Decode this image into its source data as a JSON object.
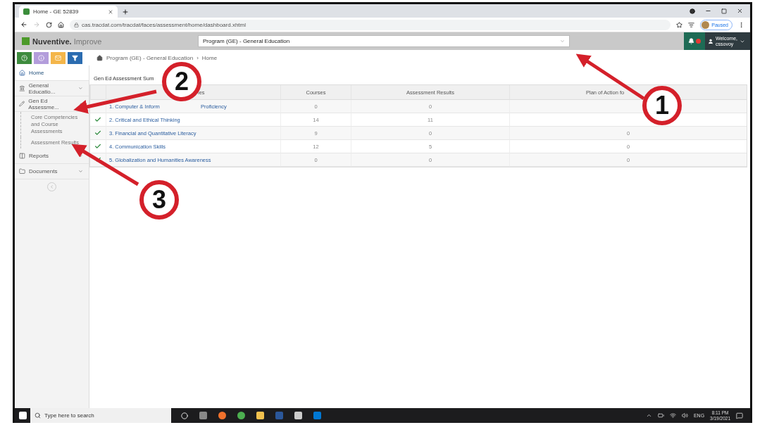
{
  "browser": {
    "tab": {
      "title": "Home - GE 52839"
    },
    "address": "cas.tracdat.com/tracdat/faces/assessment/home/dashboard.xhtml",
    "profile": "Paused"
  },
  "header": {
    "logo": {
      "brand": "Nuventive.",
      "product": "Improve"
    },
    "unit_select": {
      "value": "Program (GE) - General Education"
    },
    "notifications": {
      "unread": true
    },
    "user": {
      "greeting": "Welcome,",
      "name": "cssovoy"
    }
  },
  "breadcrumb": {
    "items": [
      "Program (GE) - General Education",
      "Home"
    ],
    "separator": "›"
  },
  "sidebar": {
    "items": [
      {
        "label": "Home",
        "selected": true
      },
      {
        "label": "General Educatio...",
        "selected": false,
        "expanded": false
      },
      {
        "label": "Gen Ed Assessme...",
        "selected": false,
        "expanded": true,
        "children": [
          {
            "label": "Core Competencies and Course Assessments"
          },
          {
            "label": "Assessment Results"
          }
        ]
      },
      {
        "label": "Reports",
        "selected": false,
        "expanded": false
      },
      {
        "label": "Documents",
        "selected": false,
        "expanded": false
      }
    ]
  },
  "summary": {
    "title": "Gen Ed Assessment Sum",
    "columns": [
      "ies",
      "Courses",
      "Assessment Results",
      "Plan of Action fo"
    ],
    "rows": [
      {
        "checked": false,
        "name": "1. Computer & Inform",
        "name_tail": "Proficiency",
        "courses": "0",
        "results": "0"
      },
      {
        "checked": true,
        "name": "2. Critical and Ethical Thinking",
        "courses": "14",
        "results": "11"
      },
      {
        "checked": true,
        "name": "3. Financial and Quantitative Literacy",
        "courses": "9",
        "results": "0",
        "plan": "0"
      },
      {
        "checked": true,
        "name": "4. Communication Skills",
        "courses": "12",
        "results": "5",
        "plan": "0"
      },
      {
        "checked": true,
        "name": "5. Globalization and Humanities Awareness",
        "courses": "0",
        "results": "0",
        "plan": "0"
      }
    ]
  },
  "annotations": [
    {
      "label": "1"
    },
    {
      "label": "2"
    },
    {
      "label": "3"
    }
  ],
  "taskbar": {
    "search_placeholder": "Type here to search",
    "language": "ENG",
    "time": "8:11 PM",
    "date": "3/19/2021"
  }
}
